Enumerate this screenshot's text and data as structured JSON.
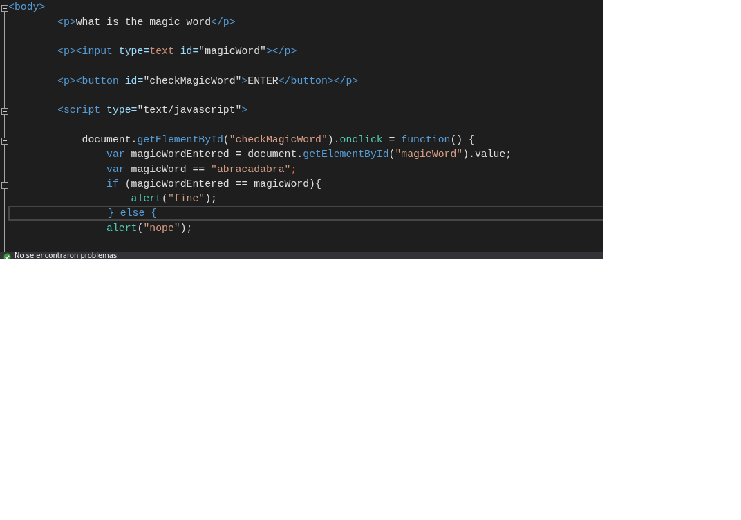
{
  "editor": {
    "lines": [
      {
        "expanded": true,
        "current": false,
        "tokens": [
          {
            "kind": "tag",
            "text": "<body>"
          }
        ]
      },
      {
        "current": false,
        "tokens": [
          {
            "kind": "tag",
            "text": "        <p>"
          },
          {
            "kind": "text",
            "text": "what is the magic word"
          },
          {
            "kind": "tag",
            "text": "</p>"
          }
        ]
      },
      {
        "current": false
      },
      {
        "current": false,
        "tokens": [
          {
            "kind": "tag",
            "text": "        <p><input "
          },
          {
            "kind": "attr",
            "text": "type="
          },
          {
            "kind": "value",
            "text": "text "
          },
          {
            "kind": "attr",
            "text": "id="
          },
          {
            "kind": "text",
            "text": "\"magicWord\""
          },
          {
            "kind": "tag",
            "text": "></p>"
          }
        ]
      },
      {
        "current": false
      },
      {
        "current": false,
        "tokens": [
          {
            "kind": "tag",
            "text": "        <p><button "
          },
          {
            "kind": "attr",
            "text": "id="
          },
          {
            "kind": "text",
            "text": "\"checkMagicWord\""
          },
          {
            "kind": "tag",
            "text": ">"
          },
          {
            "kind": "text",
            "text": "ENTER"
          },
          {
            "kind": "tag",
            "text": "</button></p>"
          }
        ]
      },
      {
        "current": false
      },
      {
        "expanded": true,
        "current": false,
        "tokens": [
          {
            "kind": "tag",
            "text": "        <script "
          },
          {
            "kind": "attr",
            "text": "type="
          },
          {
            "kind": "text",
            "text": "\"text/javascript\""
          },
          {
            "kind": "tag",
            "text": ">"
          }
        ]
      },
      {
        "current": false
      },
      {
        "expanded": true,
        "current": false,
        "tokens": [
          {
            "kind": "text",
            "text": "            document."
          },
          {
            "kind": "keyword",
            "text": "getElementById"
          },
          {
            "kind": "text",
            "text": "("
          },
          {
            "kind": "string",
            "text": "\"checkMagicWord\""
          },
          {
            "kind": "text",
            "text": ")."
          },
          {
            "kind": "func",
            "text": "onclick"
          },
          {
            "kind": "text",
            "text": " = "
          },
          {
            "kind": "keyword",
            "text": "function"
          },
          {
            "kind": "text",
            "text": "() {"
          }
        ]
      },
      {
        "current": false,
        "tokens": [
          {
            "kind": "keyword",
            "text": "                var "
          },
          {
            "kind": "text",
            "text": "magicWordEntered = document."
          },
          {
            "kind": "keyword",
            "text": "getElementById"
          },
          {
            "kind": "text",
            "text": "("
          },
          {
            "kind": "string",
            "text": "\"magicWord\""
          },
          {
            "kind": "text",
            "text": ").value;"
          }
        ]
      },
      {
        "current": false,
        "tokens": [
          {
            "kind": "keyword",
            "text": "                var "
          },
          {
            "kind": "text",
            "text": "magicWord == "
          },
          {
            "kind": "string",
            "text": "\"abracadabra\""
          },
          {
            "kind": "error",
            "text": ";"
          }
        ]
      },
      {
        "expanded": true,
        "current": false,
        "tokens": [
          {
            "kind": "keyword",
            "text": "                if "
          },
          {
            "kind": "text",
            "text": "(magicWordEntered == magicWord){"
          }
        ]
      },
      {
        "current": false,
        "tokens": [
          {
            "kind": "func",
            "text": "                    alert"
          },
          {
            "kind": "text",
            "text": "("
          },
          {
            "kind": "string",
            "text": "\"fine\""
          },
          {
            "kind": "text",
            "text": ");"
          }
        ]
      },
      {
        "current": true,
        "tokens": [
          {
            "kind": "keyword",
            "text": "                } else {"
          }
        ]
      },
      {
        "current": false,
        "tokens": [
          {
            "kind": "func",
            "text": "                alert"
          },
          {
            "kind": "text",
            "text": "("
          },
          {
            "kind": "string",
            "text": "\"nope\""
          },
          {
            "kind": "text",
            "text": ");"
          }
        ]
      },
      {
        "current": false
      }
    ]
  },
  "status_bar": {
    "message": "No se encontraron problemas"
  }
}
